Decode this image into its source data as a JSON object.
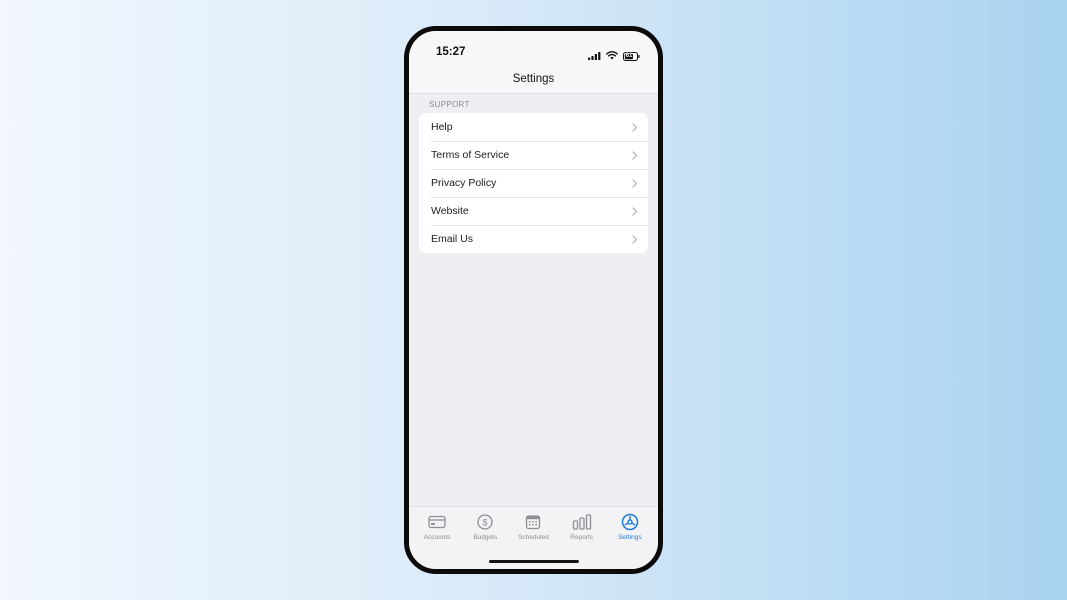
{
  "status_bar": {
    "time": "15:27",
    "battery_level": "61",
    "icons": [
      "cellular-signal-icon",
      "wifi-icon",
      "battery-icon"
    ]
  },
  "nav": {
    "title": "Settings"
  },
  "support": {
    "header": "SUPPORT",
    "items": [
      {
        "label": "Help",
        "icon": "chevron-right-icon"
      },
      {
        "label": "Terms of Service",
        "icon": "chevron-right-icon"
      },
      {
        "label": "Privacy Policy",
        "icon": "chevron-right-icon"
      },
      {
        "label": "Website",
        "icon": "chevron-right-icon"
      },
      {
        "label": "Email Us",
        "icon": "chevron-right-icon"
      }
    ]
  },
  "tab_bar": {
    "active": "Settings",
    "accent_color": "#1f7bd8",
    "inactive_color": "#8e8e93",
    "tabs": [
      {
        "label": "Accounts",
        "icon": "card-icon"
      },
      {
        "label": "Budgets",
        "icon": "dollar-circle-icon"
      },
      {
        "label": "Scheduled",
        "icon": "calendar-icon"
      },
      {
        "label": "Reports",
        "icon": "bar-chart-icon"
      },
      {
        "label": "Settings",
        "icon": "gear-icon"
      }
    ]
  }
}
